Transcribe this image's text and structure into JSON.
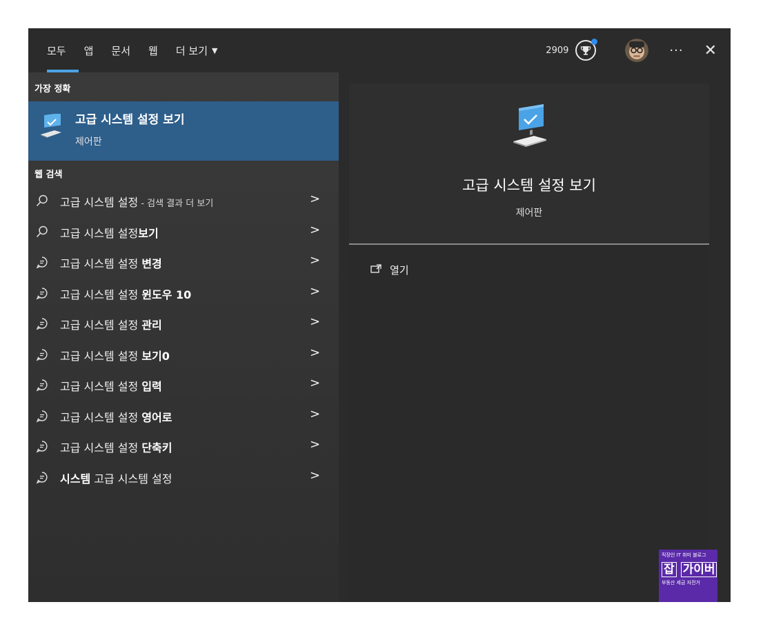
{
  "tabs": [
    {
      "label": "모두",
      "active": true
    },
    {
      "label": "앱"
    },
    {
      "label": "문서"
    },
    {
      "label": "웹"
    },
    {
      "label": "더 보기",
      "caret": "▼"
    }
  ],
  "topbar": {
    "points": "2909",
    "more_label": "···",
    "close_label": "✕",
    "accent": "#4ca3e6"
  },
  "best_match": {
    "section_label": "가장 정확",
    "title": "고급 시스템 설정 보기",
    "subtitle": "제어판",
    "highlight": "#2e5e8a"
  },
  "web": {
    "section_label": "웹 검색",
    "results": [
      {
        "icon": "search-icon",
        "prefix": "고급 시스템 설정",
        "bold": "",
        "suffix": " - 검색 결과 더 보기"
      },
      {
        "icon": "search-icon",
        "prefix": "고급 시스템 설정",
        "bold": "보기",
        "suffix": ""
      },
      {
        "icon": "suggestion-icon",
        "prefix": "고급 시스템 설정 ",
        "bold": "변경",
        "suffix": ""
      },
      {
        "icon": "suggestion-icon",
        "prefix": "고급 시스템 설정 ",
        "bold": "윈도우 10",
        "suffix": ""
      },
      {
        "icon": "suggestion-icon",
        "prefix": "고급 시스템 설정 ",
        "bold": "관리",
        "suffix": ""
      },
      {
        "icon": "suggestion-icon",
        "prefix": "고급 시스템 설정 ",
        "bold": "보기0",
        "suffix": ""
      },
      {
        "icon": "suggestion-icon",
        "prefix": "고급 시스템 설정 ",
        "bold": "입력",
        "suffix": ""
      },
      {
        "icon": "suggestion-icon",
        "prefix": "고급 시스템 설정 ",
        "bold": "영어로",
        "suffix": ""
      },
      {
        "icon": "suggestion-icon",
        "prefix": "고급 시스템 설정 ",
        "bold": "단축키",
        "suffix": ""
      },
      {
        "icon": "suggestion-icon",
        "prefix": "",
        "bold": "시스템",
        "suffix": " 고급 시스템 설정"
      }
    ],
    "chevron": ">"
  },
  "preview": {
    "title": "고급 시스템 설정 보기",
    "subtitle": "제어판",
    "open_label": "열기"
  },
  "watermark": {
    "line1": "직장인 IT 취미 블로그",
    "brand_a": "잡",
    "brand_b": "가이버",
    "line3": "부동산 세금 자전거"
  }
}
